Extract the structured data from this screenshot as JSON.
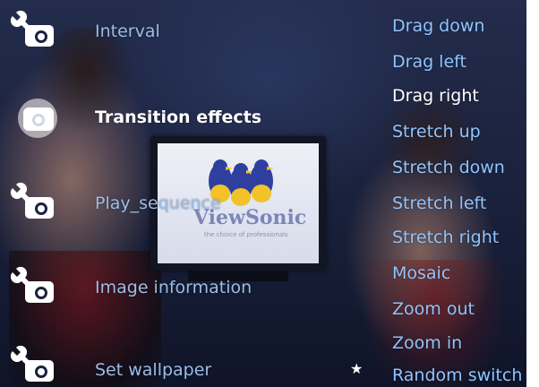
{
  "menu": {
    "items": [
      {
        "label": "Interval",
        "icon": "wrench-camera-icon"
      },
      {
        "label": "Transition effects",
        "icon": "camera-icon",
        "selected": true
      },
      {
        "label": "Play_sequence",
        "icon": "wrench-camera-icon"
      },
      {
        "label": "Image information",
        "icon": "wrench-camera-icon"
      },
      {
        "label": "Set wallpaper",
        "icon": "wrench-camera-icon"
      }
    ]
  },
  "submenu": {
    "items": [
      {
        "label": "Drag down"
      },
      {
        "label": "Drag left"
      },
      {
        "label": "Drag right",
        "selected": true
      },
      {
        "label": "Stretch up"
      },
      {
        "label": "Stretch down"
      },
      {
        "label": "Stretch left"
      },
      {
        "label": "Stretch right"
      },
      {
        "label": "Mosaic"
      },
      {
        "label": "Zoom out"
      },
      {
        "label": "Zoom in"
      },
      {
        "label": "Random switch",
        "current": true
      }
    ],
    "current_marker": "★"
  },
  "background": {
    "brand": "ViewSonic",
    "tagline": "the choice of professionals"
  },
  "colors": {
    "menu_text": "#9bbde8",
    "submenu_text": "#8fc4ff",
    "selected_text": "#ffffff",
    "background": "#1a2140"
  }
}
